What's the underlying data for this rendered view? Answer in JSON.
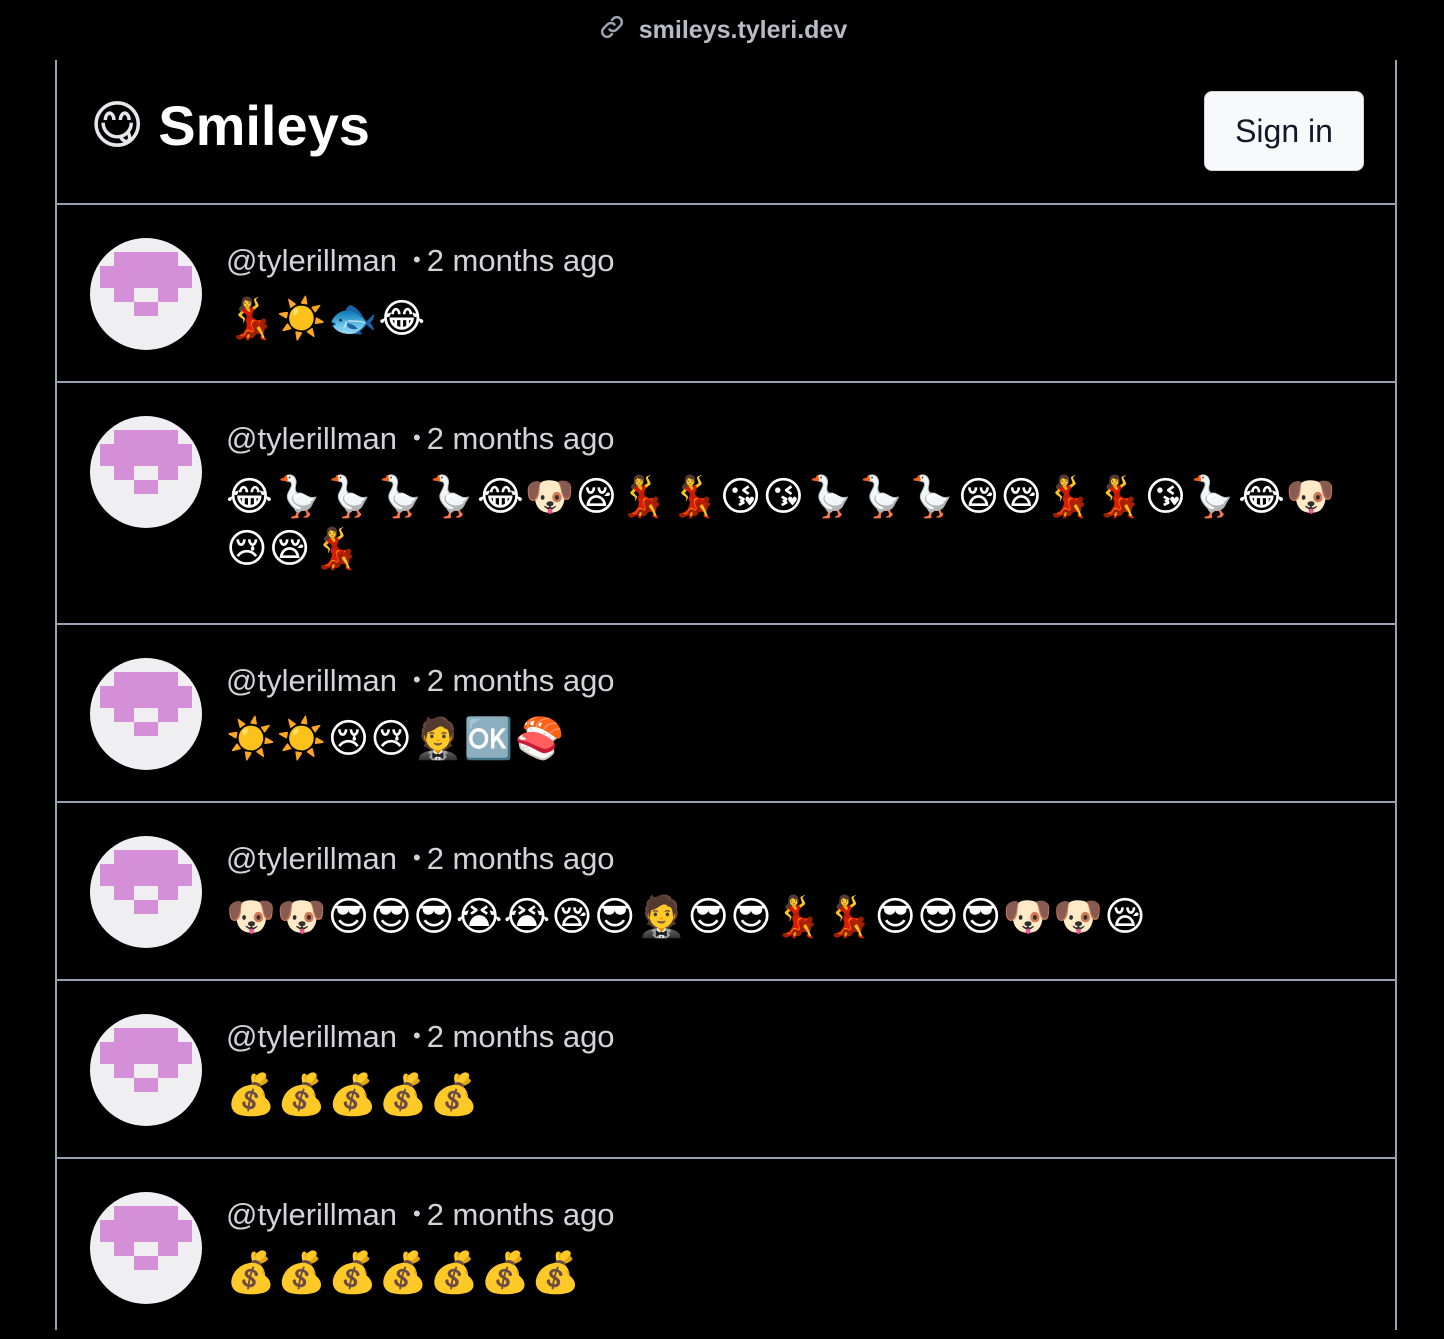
{
  "browser": {
    "url": "smileys.tyleri.dev"
  },
  "header": {
    "logo_emoji": "😋",
    "title": "Smileys",
    "signin_label": "Sign in"
  },
  "posts": [
    {
      "user": "@tylerillman",
      "time": "2 months ago",
      "content": "💃☀️🐟😂"
    },
    {
      "user": "@tylerillman",
      "time": "2 months ago",
      "content": "😂🪿🪿🪿🪿😂🐶😪💃💃😘😘🪿🪿🪿😪😪💃💃😘🪿😂🐶😢😪💃"
    },
    {
      "user": "@tylerillman",
      "time": "2 months ago",
      "content": "☀️☀️😢😢🤵🆗🍣"
    },
    {
      "user": "@tylerillman",
      "time": "2 months ago",
      "content": "🐶🐶😎😎😎😭😭😪😎🤵😎😎💃💃😎😎😎🐶🐶😪"
    },
    {
      "user": "@tylerillman",
      "time": "2 months ago",
      "content": "💰💰💰💰💰"
    },
    {
      "user": "@tylerillman",
      "time": "2 months ago",
      "content": "💰💰💰💰💰💰💰"
    }
  ],
  "colors": {
    "background": "#000000",
    "border": "#9aa0b4",
    "avatar_bg": "#efeff1",
    "avatar_fg": "#d48fd8"
  }
}
